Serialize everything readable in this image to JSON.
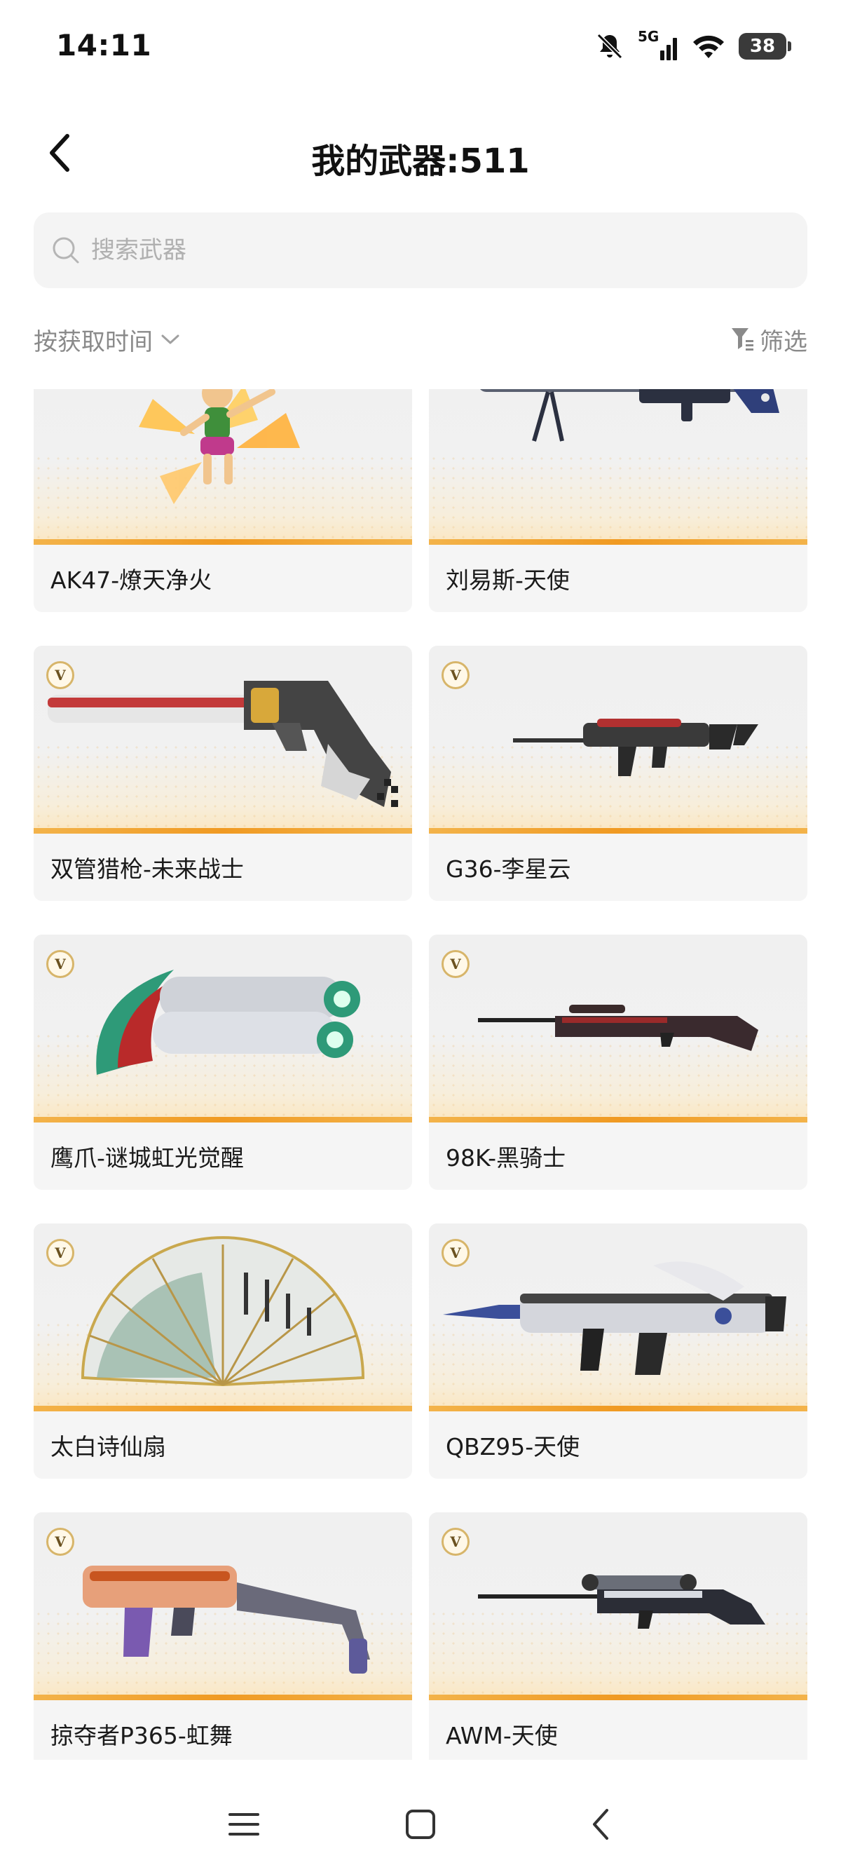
{
  "status_bar": {
    "time": "14:11",
    "network": "5G",
    "battery": "38"
  },
  "header": {
    "title": "我的武器:511"
  },
  "search": {
    "placeholder": "搜索武器"
  },
  "toolbar": {
    "sort_label": "按获取时间",
    "filter_label": "筛选"
  },
  "weapons": [
    {
      "name": "AK47-燎天净火",
      "badge": "",
      "icon": "character-figure-icon"
    },
    {
      "name": "刘易斯-天使",
      "badge": "",
      "icon": "machine-gun-icon"
    },
    {
      "name": "双管猎枪-未来战士",
      "badge": "V",
      "icon": "double-barrel-shotgun-icon"
    },
    {
      "name": "G36-李星云",
      "badge": "V",
      "icon": "assault-rifle-icon"
    },
    {
      "name": "鹰爪-谜城虹光觉醒",
      "badge": "V",
      "icon": "karambit-knife-icon"
    },
    {
      "name": "98K-黑骑士",
      "badge": "V",
      "icon": "sniper-rifle-icon"
    },
    {
      "name": "太白诗仙扇",
      "badge": "V",
      "icon": "folding-fan-icon"
    },
    {
      "name": "QBZ95-天使",
      "badge": "V",
      "icon": "bullpup-rifle-icon"
    },
    {
      "name": "掠夺者P365-虹舞",
      "badge": "V",
      "icon": "submachine-gun-icon"
    },
    {
      "name": "AWM-天使",
      "badge": "V",
      "icon": "sniper-rifle-icon"
    }
  ],
  "colors": {
    "accent_strip": "#f09a22",
    "card_bg": "#f5f5f5",
    "search_bg": "#f4f4f4",
    "muted_text": "#8a8a8a"
  }
}
